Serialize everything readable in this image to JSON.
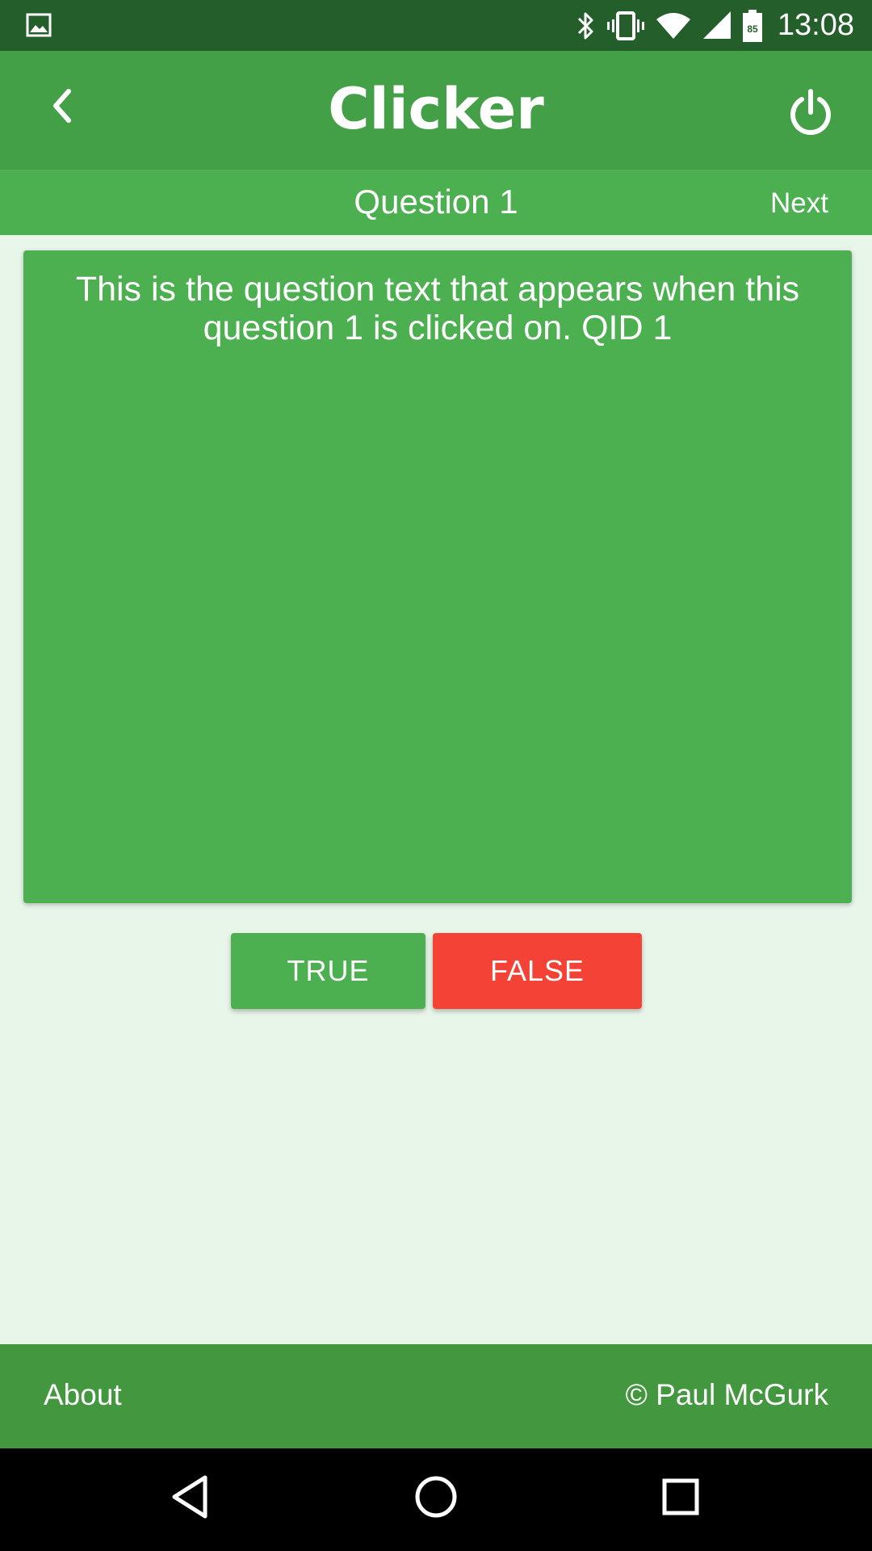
{
  "status_bar": {
    "time": "13:08",
    "battery_level": "85",
    "icons": [
      "image-notification-icon",
      "bluetooth-icon",
      "vibrate-icon",
      "wifi-icon",
      "cell-signal-icon",
      "battery-icon"
    ]
  },
  "app_bar": {
    "title": "Clicker",
    "back_icon": "chevron-left-icon",
    "power_icon": "power-icon"
  },
  "sub_bar": {
    "question_title": "Question 1",
    "next_label": "Next"
  },
  "question": {
    "text": "This is the question text that appears when this question 1 is clicked on. QID 1"
  },
  "answers": {
    "true_label": "TRUE",
    "false_label": "FALSE"
  },
  "footer": {
    "about_label": "About",
    "copyright": "© Paul McGurk"
  },
  "nav_bar": {
    "icons": [
      "nav-back-icon",
      "nav-home-icon",
      "nav-recents-icon"
    ]
  },
  "colors": {
    "status_bar": "#245e2a",
    "app_bar": "#43a047",
    "sub_bar": "#4caf50",
    "card": "#4caf50",
    "true_button": "#4caf50",
    "false_button": "#f44336",
    "footer": "#43973f",
    "background": "#e8f5e9"
  }
}
